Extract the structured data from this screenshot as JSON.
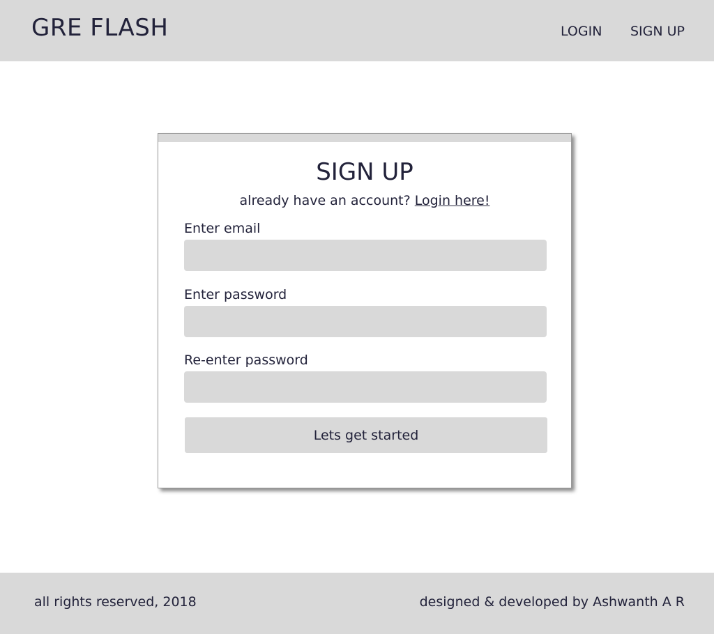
{
  "header": {
    "brand": "GRE FLASH",
    "nav": {
      "login": "LOGIN",
      "signup": "SIGN UP"
    }
  },
  "signup_form": {
    "title": "SIGN UP",
    "subtitle_prefix": "already have an account? ",
    "login_link": "Login here!",
    "email_label": "Enter email",
    "email_value": "",
    "password_label": "Enter password",
    "password_value": "",
    "reenter_label": "Re-enter password",
    "reenter_value": "",
    "submit_label": "Lets get started"
  },
  "footer": {
    "left": "all rights reserved, 2018",
    "right": "designed & developed by Ashwanth A R"
  },
  "colors": {
    "bar_bg": "#d9d9d9",
    "text": "#22223a",
    "page_bg": "#ffffff"
  }
}
